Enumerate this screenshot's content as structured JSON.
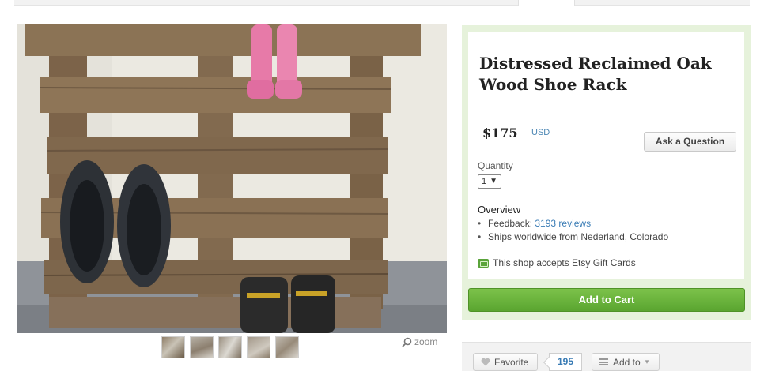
{
  "listing": {
    "title": "Distressed Reclaimed Oak Wood Shoe Rack",
    "price": "$175",
    "currency": "USD",
    "ask_button": "Ask a Question",
    "quantity_label": "Quantity",
    "quantity_value": "1",
    "overview_heading": "Overview",
    "feedback_prefix": "Feedback: ",
    "feedback_link": "3193 reviews",
    "ships_text": "Ships worldwide from Nederland, Colorado",
    "giftcard_text": "This shop accepts Etsy Gift Cards",
    "add_to_cart": "Add to Cart"
  },
  "gallery": {
    "zoom_label": "zoom",
    "thumbnail_count": 5
  },
  "social": {
    "favorite_label": "Favorite",
    "favorite_count": "195",
    "add_to_label": "Add to"
  },
  "icons": {
    "zoom": "magnifier-icon",
    "favorite": "heart-icon",
    "add_to": "list-icon",
    "giftcard": "giftcard-icon"
  },
  "colors": {
    "accent_green": "#5aa530",
    "link_blue": "#3a7cb5",
    "panel_green": "#e6f2db"
  }
}
